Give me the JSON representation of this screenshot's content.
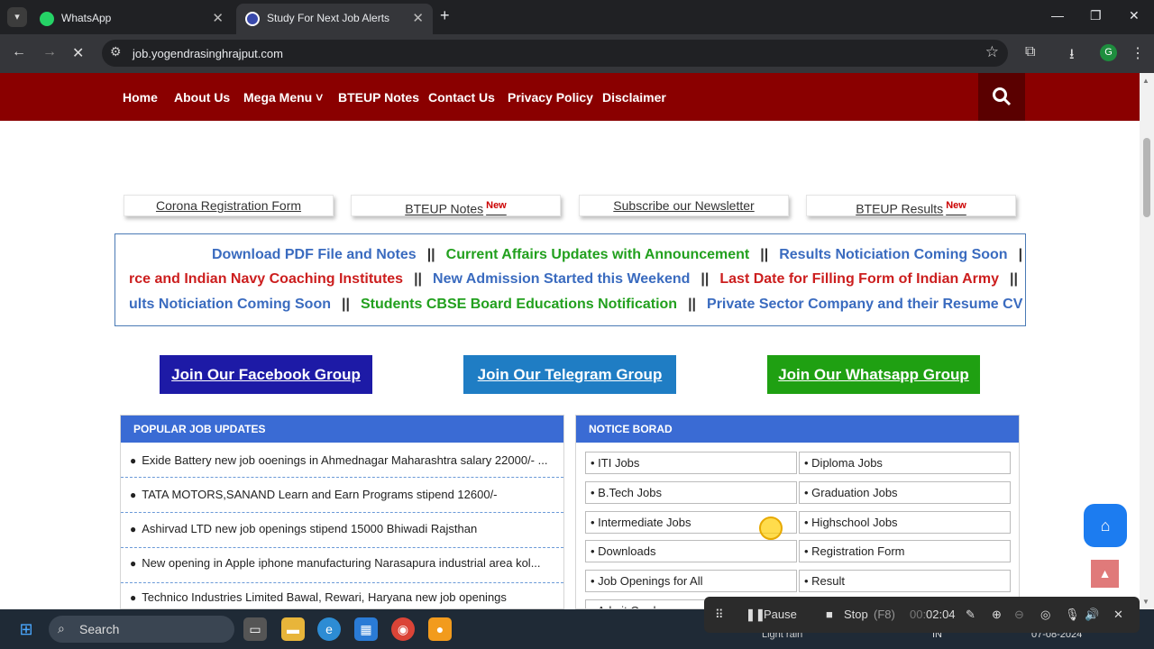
{
  "browser": {
    "tabs": [
      {
        "title": "WhatsApp",
        "icon": "whatsapp-icon"
      },
      {
        "title": "Study For Next Job Alerts",
        "icon": "site-icon",
        "active": true
      }
    ],
    "url": "job.yogendrasinghrajput.com",
    "profile_initial": "G"
  },
  "nav": {
    "items": [
      "Home",
      "About Us",
      "Mega Menu ˅",
      "BTEUP Notes",
      "Contact Us",
      "Privacy Policy",
      "Disclaimer"
    ]
  },
  "quick_links": [
    {
      "label": "Corona Registration Form",
      "badge": ""
    },
    {
      "label": "BTEUP Notes",
      "badge": "New"
    },
    {
      "label": "Subscribe our Newsletter",
      "badge": ""
    },
    {
      "label": "BTEUP Results",
      "badge": "New"
    }
  ],
  "marquee": {
    "rows": [
      [
        {
          "text": "Download PDF File and Notes",
          "color": "blue"
        },
        {
          "text": "Current Affairs Updates with Announcement",
          "color": "green"
        },
        {
          "text": "Results Noticiation Coming Soon",
          "color": "blue"
        }
      ],
      [
        {
          "text": "rce and Indian Navy Coaching Institutes",
          "color": "red"
        },
        {
          "text": "New Admission Started this Weekend",
          "color": "blue"
        },
        {
          "text": "Last Date for Filling Form of Indian Army",
          "color": "red"
        }
      ],
      [
        {
          "text": "ults Noticiation Coming Soon",
          "color": "blue"
        },
        {
          "text": "Students CBSE Board Educations Notification",
          "color": "green"
        },
        {
          "text": "Private Sector Company and their Resume CV",
          "color": "blue"
        }
      ]
    ],
    "separator": "||",
    "trailing_separator": "|"
  },
  "join": {
    "facebook": "Join Our Facebook Group",
    "telegram": "Join Our Telegram Group",
    "whatsapp": "Join Our Whatsapp Group"
  },
  "popular": {
    "title": "POPULAR JOB UPDATES",
    "items": [
      "Exide Battery new job ooenings in Ahmednagar Maharashtra salary 22000/- ...",
      "TATA MOTORS,SANAND Learn and Earn Programs stipend 12600/-",
      "Ashirvad LTD new job openings stipend 15000 Bhiwadi Rajsthan",
      "New opening in Apple iphone manufacturing Narasapura industrial area kol...",
      "Technico Industries Limited Bawal, Rewari, Haryana new job openings"
    ]
  },
  "notice": {
    "title": "NOTICE BORAD",
    "items": [
      "• ITI Jobs",
      "• Diploma Jobs",
      "• B.Tech Jobs",
      "• Graduation Jobs",
      "• Intermediate Jobs",
      "• Highschool Jobs",
      "• Downloads",
      "• Registration Form",
      "• Job Openings for All",
      "• Result",
      "• Admit Card",
      ""
    ]
  },
  "recorder": {
    "pause": "Pause",
    "stop": "Stop",
    "stop_key": "(F8)",
    "time_prefix": "00:",
    "time": "02:04"
  },
  "taskbar": {
    "search": "Search",
    "weather": "Light rain",
    "lang": "IN",
    "date": "07-08-2024"
  },
  "colors": {
    "nav_bg": "#8a0000",
    "panel_head": "#3a6bd4",
    "facebook": "#1d1aa6",
    "telegram": "#1f7dc4",
    "whatsapp": "#1fa012"
  }
}
